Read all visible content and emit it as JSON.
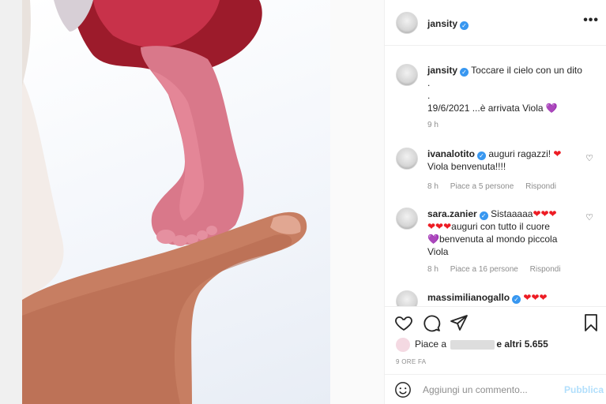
{
  "post": {
    "author": "jansity",
    "more_glyph": "•••"
  },
  "caption": {
    "username": "jansity",
    "line1": "Toccare il cielo con un dito",
    "line2": ".",
    "line3": ".",
    "line4": "19/6/2021 ...è arrivata Viola",
    "line4_emoji": "💜",
    "time": "9 h"
  },
  "comments": [
    {
      "username": "ivanalotito",
      "text_a": "auguri ragazzi!",
      "emoji_a": "❤",
      "text_b": "Viola benvenuta!!!!",
      "time": "8 h",
      "likes": "Piace a 5 persone",
      "reply": "Rispondi"
    },
    {
      "username": "sara.zanier",
      "text_a": "Sistaaaaa",
      "emoji_a": "❤❤❤",
      "emoji_b": "❤❤❤",
      "text_b": "auguri con tutto il cuore",
      "emoji_c": "💜",
      "text_c": "benvenuta al mondo piccola",
      "text_d": "Viola",
      "time": "8 h",
      "likes": "Piace a 16 persone",
      "reply": "Rispondi"
    },
    {
      "username": "massimilianogallo",
      "emoji_a": "❤❤❤"
    }
  ],
  "likes": {
    "prefix": "Piace a",
    "suffix": "e altri 5.655"
  },
  "date": "9 ORE FA",
  "comment_input": {
    "placeholder": "Aggiungi un commento...",
    "publish": "Pubblica"
  },
  "icons": {
    "like": "heart-icon",
    "comment": "comment-icon",
    "share": "send-icon",
    "save": "bookmark-icon",
    "emoji": "smiley-icon"
  },
  "colors": {
    "verified": "#3897f0",
    "heart_red": "#ed1c24",
    "heart_purple": "#8e67c9",
    "publish_disabled": "#b2dffc"
  }
}
